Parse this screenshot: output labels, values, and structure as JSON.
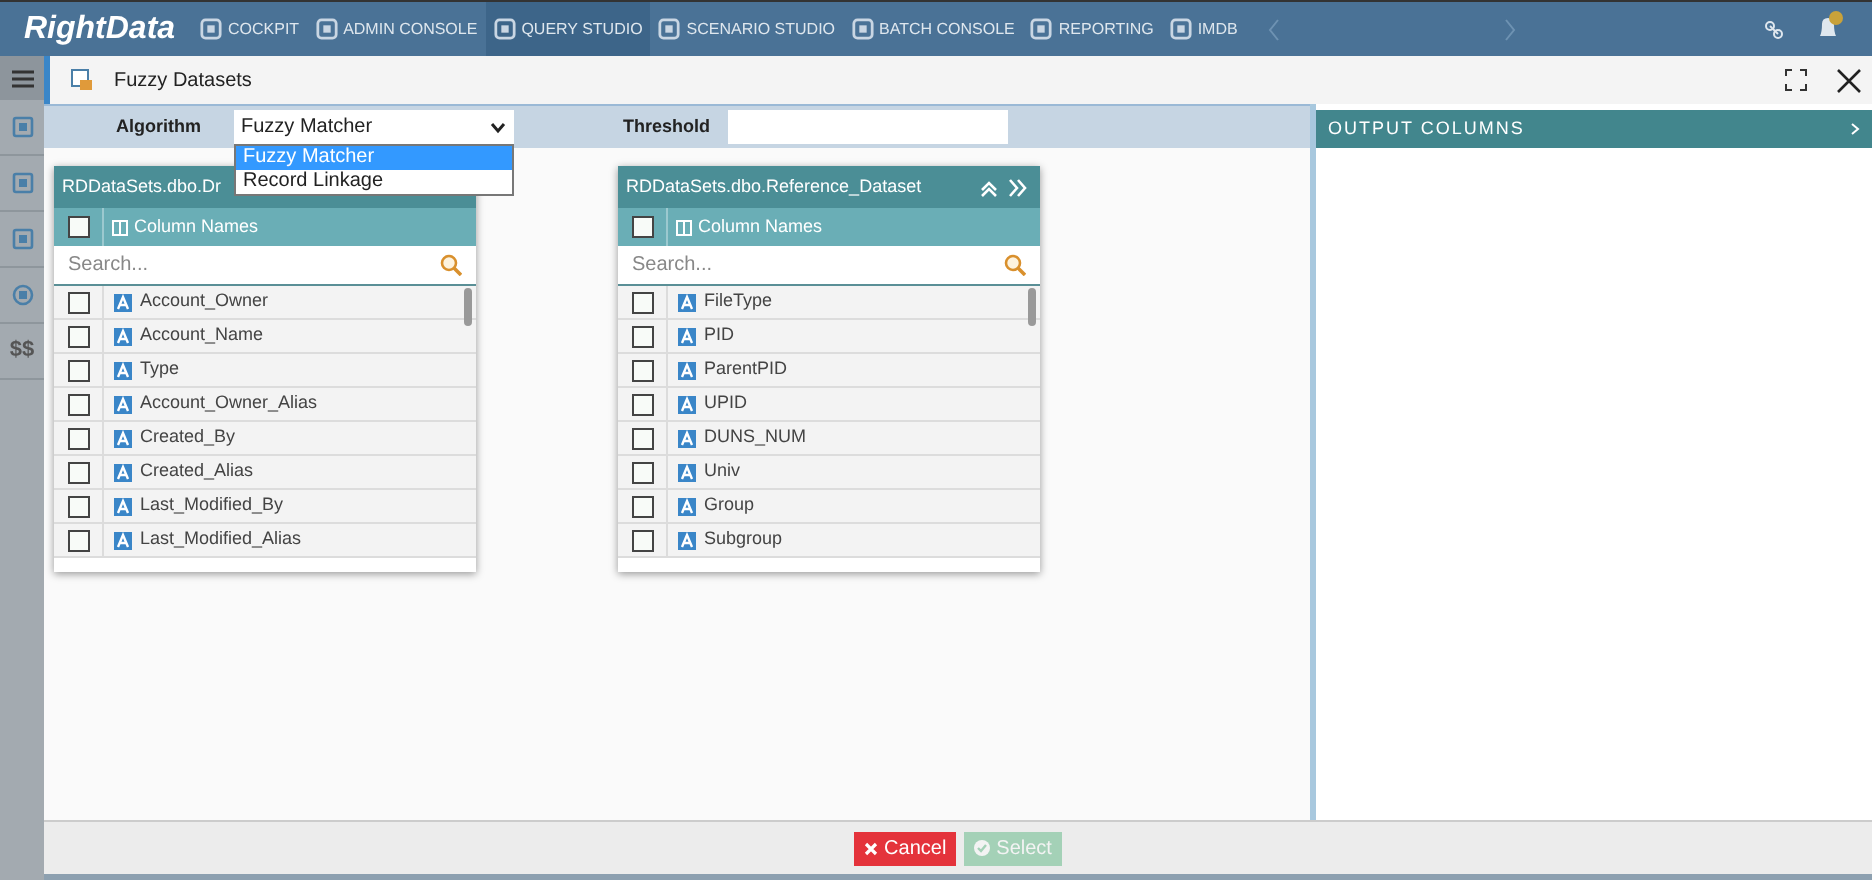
{
  "logo": "RightData",
  "nav": [
    {
      "label": "COCKPIT",
      "selected": false
    },
    {
      "label": "ADMIN CONSOLE",
      "selected": false
    },
    {
      "label": "QUERY STUDIO",
      "selected": true
    },
    {
      "label": "SCENARIO STUDIO",
      "selected": false
    },
    {
      "label": "BATCH CONSOLE",
      "selected": false
    },
    {
      "label": "REPORTING",
      "selected": false
    },
    {
      "label": "IMDB",
      "selected": false
    }
  ],
  "sidebar_extra": "$$",
  "dialog": {
    "title": "Fuzzy Datasets"
  },
  "algorithm": {
    "label": "Algorithm",
    "value": "Fuzzy Matcher",
    "expanded": true,
    "options": [
      {
        "label": "Fuzzy Matcher",
        "selected": true
      },
      {
        "label": "Record Linkage",
        "selected": false
      }
    ]
  },
  "threshold": {
    "label": "Threshold"
  },
  "datasets": [
    {
      "title": "RDDataSets.dbo.Dr",
      "header": "Column Names",
      "all_checked": false,
      "search_placeholder": "Search...",
      "columns": [
        {
          "name": "Account_Owner",
          "checked": false
        },
        {
          "name": "Account_Name",
          "checked": false
        },
        {
          "name": "Type",
          "checked": false
        },
        {
          "name": "Account_Owner_Alias",
          "checked": false
        },
        {
          "name": "Created_By",
          "checked": false
        },
        {
          "name": "Created_Alias",
          "checked": false
        },
        {
          "name": "Last_Modified_By",
          "checked": false
        },
        {
          "name": "Last_Modified_Alias",
          "checked": false
        }
      ]
    },
    {
      "title": "RDDataSets.dbo.Reference_Dataset",
      "header": "Column Names",
      "all_checked": false,
      "search_placeholder": "Search...",
      "columns": [
        {
          "name": "FileType",
          "checked": false
        },
        {
          "name": "PID",
          "checked": false
        },
        {
          "name": "ParentPID",
          "checked": false
        },
        {
          "name": "UPID",
          "checked": false
        },
        {
          "name": "DUNS_NUM",
          "checked": false
        },
        {
          "name": "Univ",
          "checked": false
        },
        {
          "name": "Group",
          "checked": false
        },
        {
          "name": "Subgroup",
          "checked": false
        }
      ]
    }
  ],
  "output": {
    "title": "OUTPUT COLUMNS"
  },
  "buttons": [
    {
      "label": "Cancel",
      "kind": "cancel",
      "disabled": false
    },
    {
      "label": "Select",
      "kind": "select",
      "disabled": true
    }
  ]
}
